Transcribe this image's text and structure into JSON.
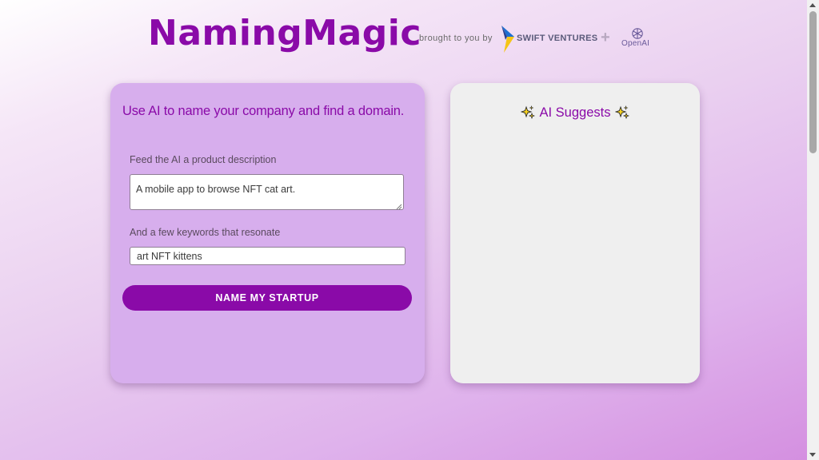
{
  "header": {
    "brand": "NamingMagic",
    "brought_by": "brought to you by",
    "partner_swift": "SWIFT VENTURES",
    "plus": "+",
    "partner_openai": "OpenAI"
  },
  "form": {
    "heading": "Use AI to name your company and find a domain.",
    "description_label": "Feed the AI a product description",
    "description_value": "A mobile app to browse NFT cat art.",
    "keywords_label": "And a few keywords that resonate",
    "keywords_value": "art NFT kittens",
    "submit_label": "NAME MY STARTUP"
  },
  "results": {
    "title": "AI Suggests"
  },
  "colors": {
    "brand": "#8a0aa8",
    "left_card": "#d7aeed",
    "right_card": "#efefef"
  },
  "icons": {
    "swift": "swift-ventures-logo-icon",
    "openai": "openai-logo-icon",
    "sparkle": "sparkles-icon"
  }
}
